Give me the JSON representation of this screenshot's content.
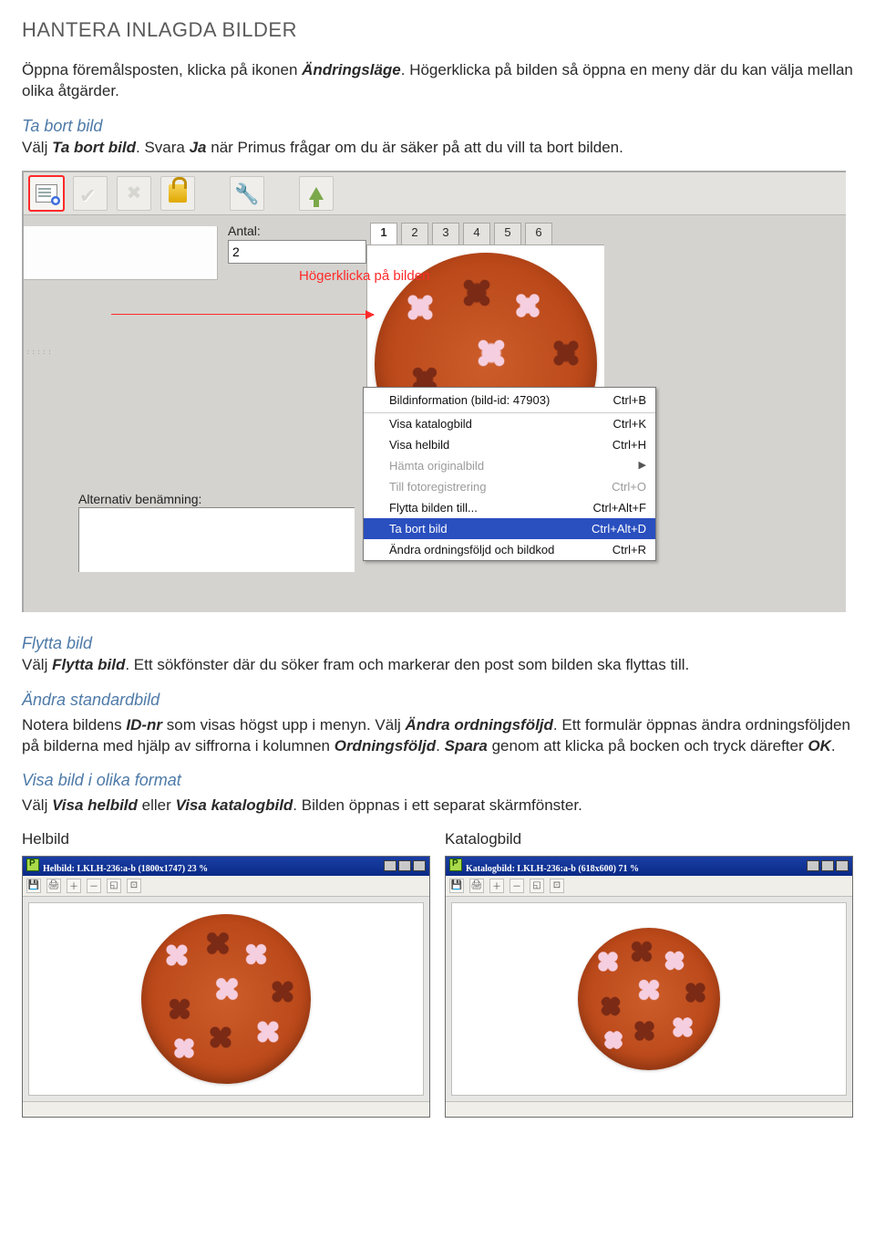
{
  "heading": "HANTERA INLAGDA BILDER",
  "intro": {
    "p1a": "Öppna föremålsposten, klicka på ikonen ",
    "p1b": "Ändringsläge",
    "p1c": ". Högerklicka på bilden så öppna en meny där du kan välja mellan olika åtgärder."
  },
  "taBort": {
    "title": "Ta bort bild",
    "b1a": "Välj ",
    "b1b": "Ta bort bild",
    "b1c": ". Svara ",
    "b1d": "Ja",
    "b1e": " när Primus frågar om du är säker på att du vill ta bort bilden."
  },
  "shot": {
    "antalLabel": "Antal:",
    "antalValue": "2",
    "tabs": [
      "1",
      "2",
      "3",
      "4",
      "5",
      "6"
    ],
    "redNote": "Högerklicka på bilden",
    "altLabel": "Alternativ benämning:",
    "menu": [
      {
        "label": "Bildinformation (bild-id: 47903)",
        "sc": "Ctrl+B",
        "topsep": true
      },
      {
        "label": "Visa katalogbild",
        "sc": "Ctrl+K"
      },
      {
        "label": "Visa helbild",
        "sc": "Ctrl+H"
      },
      {
        "label": "Hämta originalbild",
        "sc": "",
        "disabled": true,
        "submenu": true
      },
      {
        "label": "Till fotoregistrering",
        "sc": "Ctrl+O",
        "disabled": true
      },
      {
        "label": "Flytta bilden till...",
        "sc": "Ctrl+Alt+F"
      },
      {
        "label": "Ta bort bild",
        "sc": "Ctrl+Alt+D",
        "selected": true
      },
      {
        "label": "Ändra ordningsföljd och bildkod",
        "sc": "Ctrl+R"
      }
    ]
  },
  "flytta": {
    "title": "Flytta bild",
    "b1a": "Välj ",
    "b1b": "Flytta bild",
    "b1c": ". Ett sökfönster där du söker fram och markerar den post som bilden ska flyttas till."
  },
  "andra": {
    "title": "Ändra standardbild",
    "p1a": "Notera bildens ",
    "p1b": "ID-nr",
    "p1c": " som visas högst upp i menyn. Välj ",
    "p1d": "Ändra ordningsföljd",
    "p1e": ". Ett formulär öppnas ändra ordningsföljden på bilderna med hjälp av siffrorna i kolumnen ",
    "p1f": "Ordningsföljd",
    "p1g": ". ",
    "p1h": "Spara",
    "p1i": " genom att klicka på bocken och tryck därefter ",
    "p1j": "OK",
    "p1k": "."
  },
  "visa": {
    "title": "Visa bild i olika format",
    "b1a": "Välj ",
    "b1b": "Visa helbild",
    "b1c": " eller ",
    "b1d": "Visa katalogbild",
    "b1e": ". Bilden öppnas i ett separat skärmfönster."
  },
  "thumbs": {
    "left": {
      "caption": "Helbild",
      "title": "Helbild: LKLH-236:a-b (1800x1747) 23 %"
    },
    "right": {
      "caption": "Katalogbild",
      "title": "Katalogbild: LKLH-236:a-b (618x600) 71 %"
    }
  }
}
